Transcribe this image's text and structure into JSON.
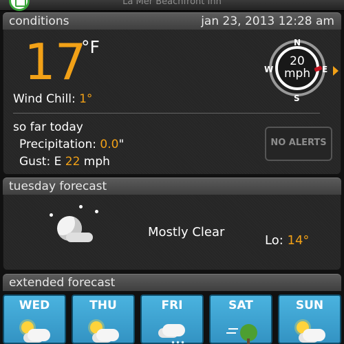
{
  "header": {
    "station": "La Mer Beachfront Inn",
    "logo_icon": "weather-station-logo-icon"
  },
  "conditions": {
    "title": "conditions",
    "date": "jan 23, 2013 12:28 am",
    "temperature": "17",
    "unit": "°F",
    "wind_chill_label": "Wind Chill:",
    "wind_chill_value": "1°",
    "so_far_today": "so far today",
    "precip_label": "Precipitation:",
    "precip_value": "0.0",
    "precip_unit": "\"",
    "gust_label": "Gust: E",
    "gust_value": "22",
    "gust_unit": "mph",
    "alerts_label": "NO ALERTS",
    "compass": {
      "speed": "20",
      "speed_unit": "mph",
      "north": "N",
      "south": "S",
      "east": "E",
      "west": "W"
    }
  },
  "tuesday": {
    "title": "tuesday forecast",
    "condition": "Mostly Clear",
    "low_label": "Lo:",
    "low_value": "14°",
    "icon": "moon-cloud-icon"
  },
  "extended": {
    "title": "extended forecast",
    "days": [
      {
        "label": "WED",
        "icon": "sun-cloud-icon"
      },
      {
        "label": "THU",
        "icon": "sun-cloud-icon"
      },
      {
        "label": "FRI",
        "icon": "snow-cloud-icon"
      },
      {
        "label": "SAT",
        "icon": "windy-tree-icon"
      },
      {
        "label": "SUN",
        "icon": "sun-cloud-icon"
      }
    ]
  },
  "colors": {
    "accent": "#f2a117",
    "forecast_card": "#44aee0"
  }
}
